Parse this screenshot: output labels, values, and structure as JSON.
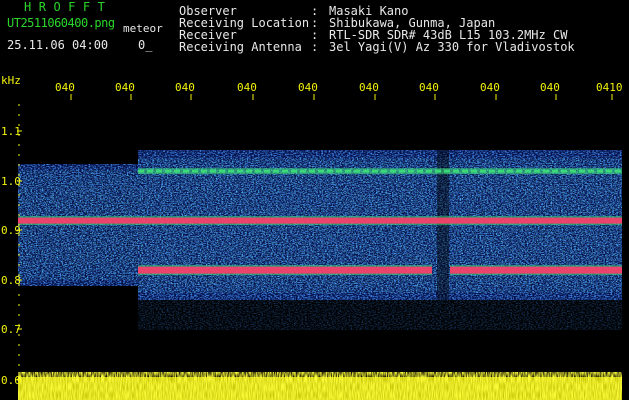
{
  "header": {
    "app_title": "HROFFT",
    "filename": "UT2511060400.png",
    "meteor_label": "meteor",
    "timestamp": "25.11.06 04:00",
    "counter": "0_"
  },
  "station_info": [
    {
      "label": "Observer",
      "value": "Masaki Kano"
    },
    {
      "label": "Receiving Location",
      "value": "Shibukawa, Gunma, Japan"
    },
    {
      "label": "Receiver",
      "value": "RTL-SDR SDR# 43dB L15 103.2MHz CW"
    },
    {
      "label": "Receiving Antenna",
      "value": "3el Yagi(V) Az 330 for Vladivostok"
    }
  ],
  "colon": ":",
  "spectrogram": {
    "unit_label": "kHz",
    "time_ticks": [
      "040",
      "040",
      "040",
      "040",
      "040",
      "040",
      "040",
      "040",
      "040",
      "0410"
    ],
    "freq_ticks": [
      "1.1",
      "1.0",
      "0.9",
      "0.8",
      "0.7",
      "0.6"
    ],
    "colors": {
      "background": "#000000",
      "noise_dark": "#0a1a8c",
      "noise_mid": "#1f5ad6",
      "noise_bright": "#25b4e0",
      "signal_green": "#3ee07a",
      "signal_red": "#ff3a6a",
      "amplitude_bar": "#f2f20a",
      "grid_tick": "#f2f20a"
    },
    "carriers_khz": [
      0.92,
      0.82,
      1.02
    ]
  }
}
